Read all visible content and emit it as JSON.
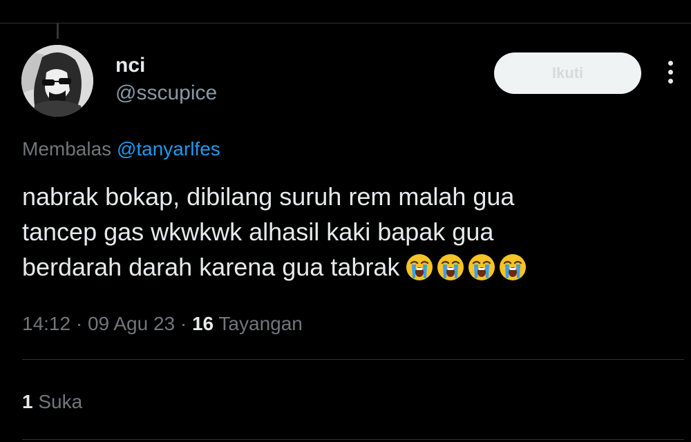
{
  "tweet": {
    "author": {
      "display_name": "nci",
      "handle": "@sscupice",
      "avatar_icon": "profile-photo"
    },
    "follow_label": "Ikuti",
    "more_icon": "more-vertical-icon",
    "reply_prefix": "Membalas",
    "reply_to": "@tanyarlfes",
    "text_lines": [
      "nabrak bokap, dibilang suruh rem malah gua",
      "tancep gas wkwkwk alhasil kaki bapak gua",
      "berdarah darah karena gua tabrak"
    ],
    "emoji": "loudly-crying-face",
    "emoji_count": 4,
    "time": "14:12",
    "date": "09 Agu 23",
    "separator": "·",
    "views_count": "16",
    "views_label": "Tayangan",
    "likes_count": "1",
    "likes_label": "Suka"
  },
  "colors": {
    "background": "#000000",
    "text_primary": "#e7e9ea",
    "text_secondary": "#71767b",
    "accent": "#1d9bf0",
    "divider": "#2f3336"
  }
}
